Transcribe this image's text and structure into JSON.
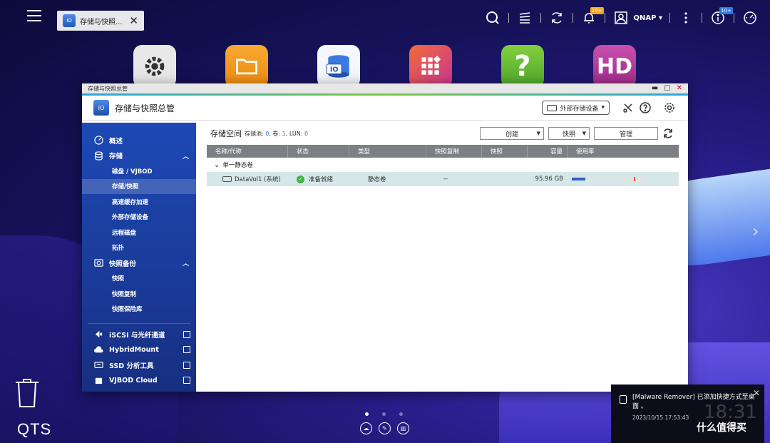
{
  "taskbar": {
    "tab_label": "存储与快照...",
    "tab_icon_text": "IO",
    "user_name": "QNAP",
    "notification_badge": "10+",
    "task_badge": "10+"
  },
  "desktop_icons": [
    {
      "name": "control-panel",
      "color": "#e0e0e0"
    },
    {
      "name": "file-station",
      "color": "#f39c1f"
    },
    {
      "name": "storage-snapshots",
      "color": "#e9f1fb"
    },
    {
      "name": "app-center",
      "color": "#e24c3f"
    },
    {
      "name": "help-center",
      "color": "#6ac23b"
    },
    {
      "name": "hd-station",
      "color": "#b9389c"
    }
  ],
  "window": {
    "titlebar": "存储与快照总管",
    "header_title": "存储与快照总管",
    "ext_button": "外部存储设备"
  },
  "sidebar": {
    "overview": "概述",
    "storage": "存储",
    "storage_items": [
      "磁盘 / VJBOD",
      "存储/快照",
      "高速缓存加速",
      "外部存储设备",
      "远程磁盘",
      "拓扑"
    ],
    "snapshot_backup": "快照备份",
    "snapshot_items": [
      "快照",
      "快照复制",
      "快照保险库"
    ],
    "iscsi": "iSCSI 与光纤通道",
    "hybridmount": "HybridMount",
    "ssd_tool": "SSD 分析工具",
    "vjbod_cloud": "VJBOD Cloud"
  },
  "main": {
    "title": "存储空间",
    "stats_pool_label": "存储池:",
    "stats_pool": "0",
    "stats_vol_label": ", 卷:",
    "stats_vol": "1",
    "stats_lun_label": ", LUN:",
    "stats_lun": "0",
    "create_button": "创建",
    "snapshot_button": "快照",
    "manage_button": "管理"
  },
  "table": {
    "headers": [
      "名称/代称",
      "状态",
      "类型",
      "快照复制",
      "快照",
      "容量",
      "使用率"
    ],
    "group": "单一静态卷",
    "rows": [
      {
        "name": "DataVol1 (系统)",
        "status": "准备就绪",
        "type": "静态卷",
        "replication": "--",
        "snapshot": "",
        "capacity": "95.96 GB",
        "usage": 0.17
      }
    ]
  },
  "bottom": {
    "qts": "QTS"
  },
  "notification": {
    "text": "[Malware Remover] 已添加快捷方式至桌面 。",
    "time": "2023/10/15 17:53:43",
    "clock": "18:31",
    "watermark": "什么值得买"
  },
  "colors": {
    "accent": "#1d49b5",
    "ok": "#44b34a"
  }
}
